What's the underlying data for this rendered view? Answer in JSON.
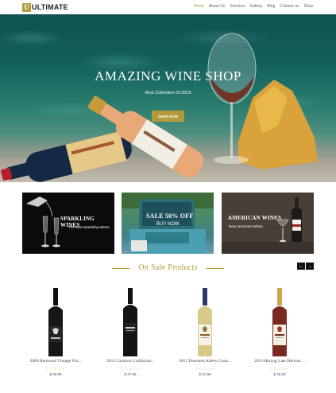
{
  "header": {
    "logo_mark": "U",
    "logo_text": "ULTIMATE",
    "nav": [
      "Home",
      "About Us",
      "Services",
      "Gallery",
      "Blog",
      "Contact us",
      "Shop"
    ],
    "active_nav": "Home"
  },
  "hero": {
    "title": "AMAZING WINE SHOP",
    "subtitle": "Best Collection Of 2019",
    "button": "SHOP NOW"
  },
  "promos": [
    {
      "title": "SPARKLING WINES",
      "subtitle": "The Best Sparkling Wines"
    },
    {
      "title": "SALE 50% OFF",
      "subtitle": "BUY NOW"
    },
    {
      "title": "AMERICAN WINES",
      "subtitle": "New American Wines"
    }
  ],
  "section": {
    "title": "On Sale Products",
    "prev_icon": "arrow-left-icon",
    "next_icon": "arrow-right-icon"
  },
  "products": [
    {
      "name": "2006 Renwood Vintage Por...",
      "stars": "☆☆☆☆☆",
      "price": "$ 59.99"
    },
    {
      "name": "2013 Carnivor California...",
      "stars": "☆☆☆☆☆",
      "price": "$ 27.98"
    },
    {
      "name": "2013 Downton Abbey Coun...",
      "stars": "☆☆☆☆☆",
      "price": "$ 31.99"
    },
    {
      "name": "2013 Herzog Late Harvest ...",
      "stars": "☆☆☆☆☆",
      "price": "$ 40.00"
    }
  ],
  "colors": {
    "accent": "#b59a3b"
  }
}
